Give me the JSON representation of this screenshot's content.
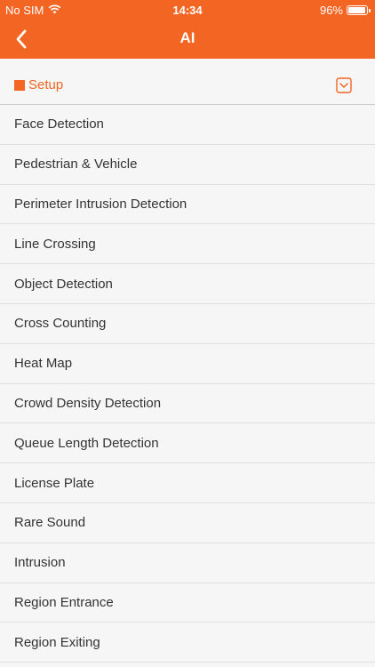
{
  "status_bar": {
    "carrier": "No SIM",
    "time": "14:34",
    "battery_percent": "96%",
    "battery_level": 0.96
  },
  "nav": {
    "title": "AI",
    "back_icon": "chevron-left-icon"
  },
  "section": {
    "label": "Setup",
    "toggle_icon": "chevron-down-icon"
  },
  "items": [
    {
      "label": "Face Detection"
    },
    {
      "label": "Pedestrian & Vehicle"
    },
    {
      "label": "Perimeter Intrusion Detection"
    },
    {
      "label": "Line Crossing"
    },
    {
      "label": "Object Detection"
    },
    {
      "label": "Cross Counting"
    },
    {
      "label": "Heat Map"
    },
    {
      "label": "Crowd Density Detection"
    },
    {
      "label": "Queue Length Detection"
    },
    {
      "label": "License Plate"
    },
    {
      "label": "Rare Sound"
    },
    {
      "label": "Intrusion"
    },
    {
      "label": "Region Entrance"
    },
    {
      "label": "Region Exiting"
    }
  ],
  "colors": {
    "accent": "#f26522",
    "background": "#f6f6f6",
    "text": "#333333"
  }
}
